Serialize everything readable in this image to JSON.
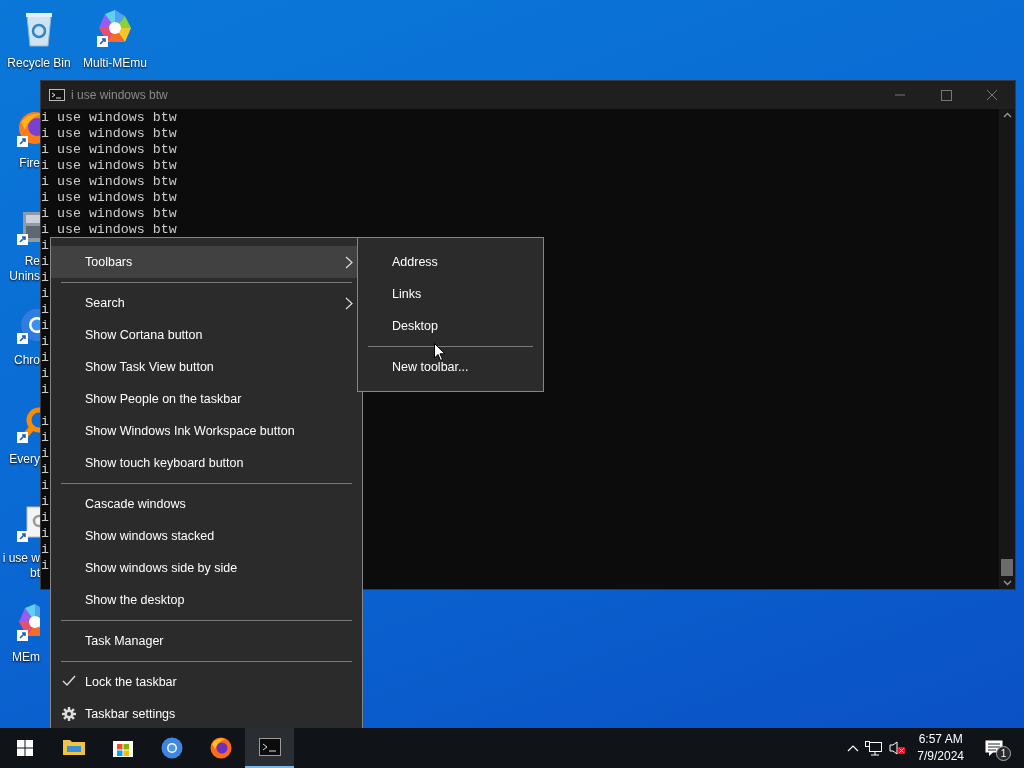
{
  "desktop_icons": [
    {
      "kind": "recycle",
      "lines": [
        "Recycle Bin"
      ]
    },
    {
      "kind": "memu",
      "lines": [
        "Multi-MEmu"
      ]
    },
    {
      "kind": "firefox",
      "lines": [
        "Fire"
      ]
    },
    {
      "kind": "revo",
      "lines": [
        "Re",
        "Unins"
      ]
    },
    {
      "kind": "chrome",
      "lines": [
        "Chro"
      ]
    },
    {
      "kind": "everything",
      "lines": [
        "Every"
      ]
    },
    {
      "kind": "file",
      "lines": [
        "i use w",
        "bt"
      ]
    },
    {
      "kind": "memu",
      "lines": [
        "MEm"
      ]
    }
  ],
  "console": {
    "title": "i use windows btw",
    "lines": [
      "i use windows btw",
      "i use windows btw",
      "i use windows btw",
      "i use windows btw",
      "i use windows btw",
      "i use windows btw",
      "i use windows btw",
      "i use windows btw",
      "i",
      "i",
      "i",
      "i",
      "i",
      "i",
      "i",
      "i",
      "i",
      "i"
    ],
    "lines_after_gap": [
      "i",
      "i",
      "i",
      "i",
      "i",
      "i",
      "i",
      "i",
      "i",
      "i"
    ]
  },
  "menu": {
    "items": [
      {
        "kind": "item",
        "label": "Toolbars",
        "selected": true,
        "checked": false,
        "submenu": true
      },
      {
        "kind": "separator"
      },
      {
        "kind": "item",
        "label": "Search",
        "selected": false,
        "checked": false,
        "submenu": true
      },
      {
        "kind": "item",
        "label": "Show Cortana button",
        "selected": false,
        "checked": false,
        "submenu": false
      },
      {
        "kind": "item",
        "label": "Show Task View button",
        "selected": false,
        "checked": false,
        "submenu": false
      },
      {
        "kind": "item",
        "label": "Show People on the taskbar",
        "selected": false,
        "checked": false,
        "submenu": false
      },
      {
        "kind": "item",
        "label": "Show Windows Ink Workspace button",
        "selected": false,
        "checked": false,
        "submenu": false
      },
      {
        "kind": "item",
        "label": "Show touch keyboard button",
        "selected": false,
        "checked": false,
        "submenu": false
      },
      {
        "kind": "separator"
      },
      {
        "kind": "item",
        "label": "Cascade windows",
        "selected": false,
        "checked": false,
        "submenu": false
      },
      {
        "kind": "item",
        "label": "Show windows stacked",
        "selected": false,
        "checked": false,
        "submenu": false
      },
      {
        "kind": "item",
        "label": "Show windows side by side",
        "selected": false,
        "checked": false,
        "submenu": false
      },
      {
        "kind": "item",
        "label": "Show the desktop",
        "selected": false,
        "checked": false,
        "submenu": false
      },
      {
        "kind": "separator"
      },
      {
        "kind": "item",
        "label": "Task Manager",
        "selected": false,
        "checked": false,
        "submenu": false
      },
      {
        "kind": "separator"
      },
      {
        "kind": "item",
        "label": "Lock the taskbar",
        "selected": false,
        "checked": true,
        "submenu": false
      },
      {
        "kind": "setting",
        "label": "Taskbar settings",
        "selected": false,
        "checked": false,
        "submenu": false
      }
    ]
  },
  "submenu": {
    "items": [
      {
        "kind": "item",
        "label": "Address"
      },
      {
        "kind": "item",
        "label": "Links"
      },
      {
        "kind": "item",
        "label": "Desktop"
      },
      {
        "kind": "separator"
      },
      {
        "kind": "item",
        "label": "New toolbar..."
      }
    ]
  },
  "taskbar": {
    "apps": [
      {
        "kind": "start",
        "active": false
      },
      {
        "kind": "explorer",
        "active": false
      },
      {
        "kind": "store",
        "active": false
      },
      {
        "kind": "chrome",
        "active": false
      },
      {
        "kind": "firefox",
        "active": false
      },
      {
        "kind": "console",
        "active": true
      }
    ],
    "time": "6:57 AM",
    "date": "7/9/2024",
    "notifications": "1"
  }
}
